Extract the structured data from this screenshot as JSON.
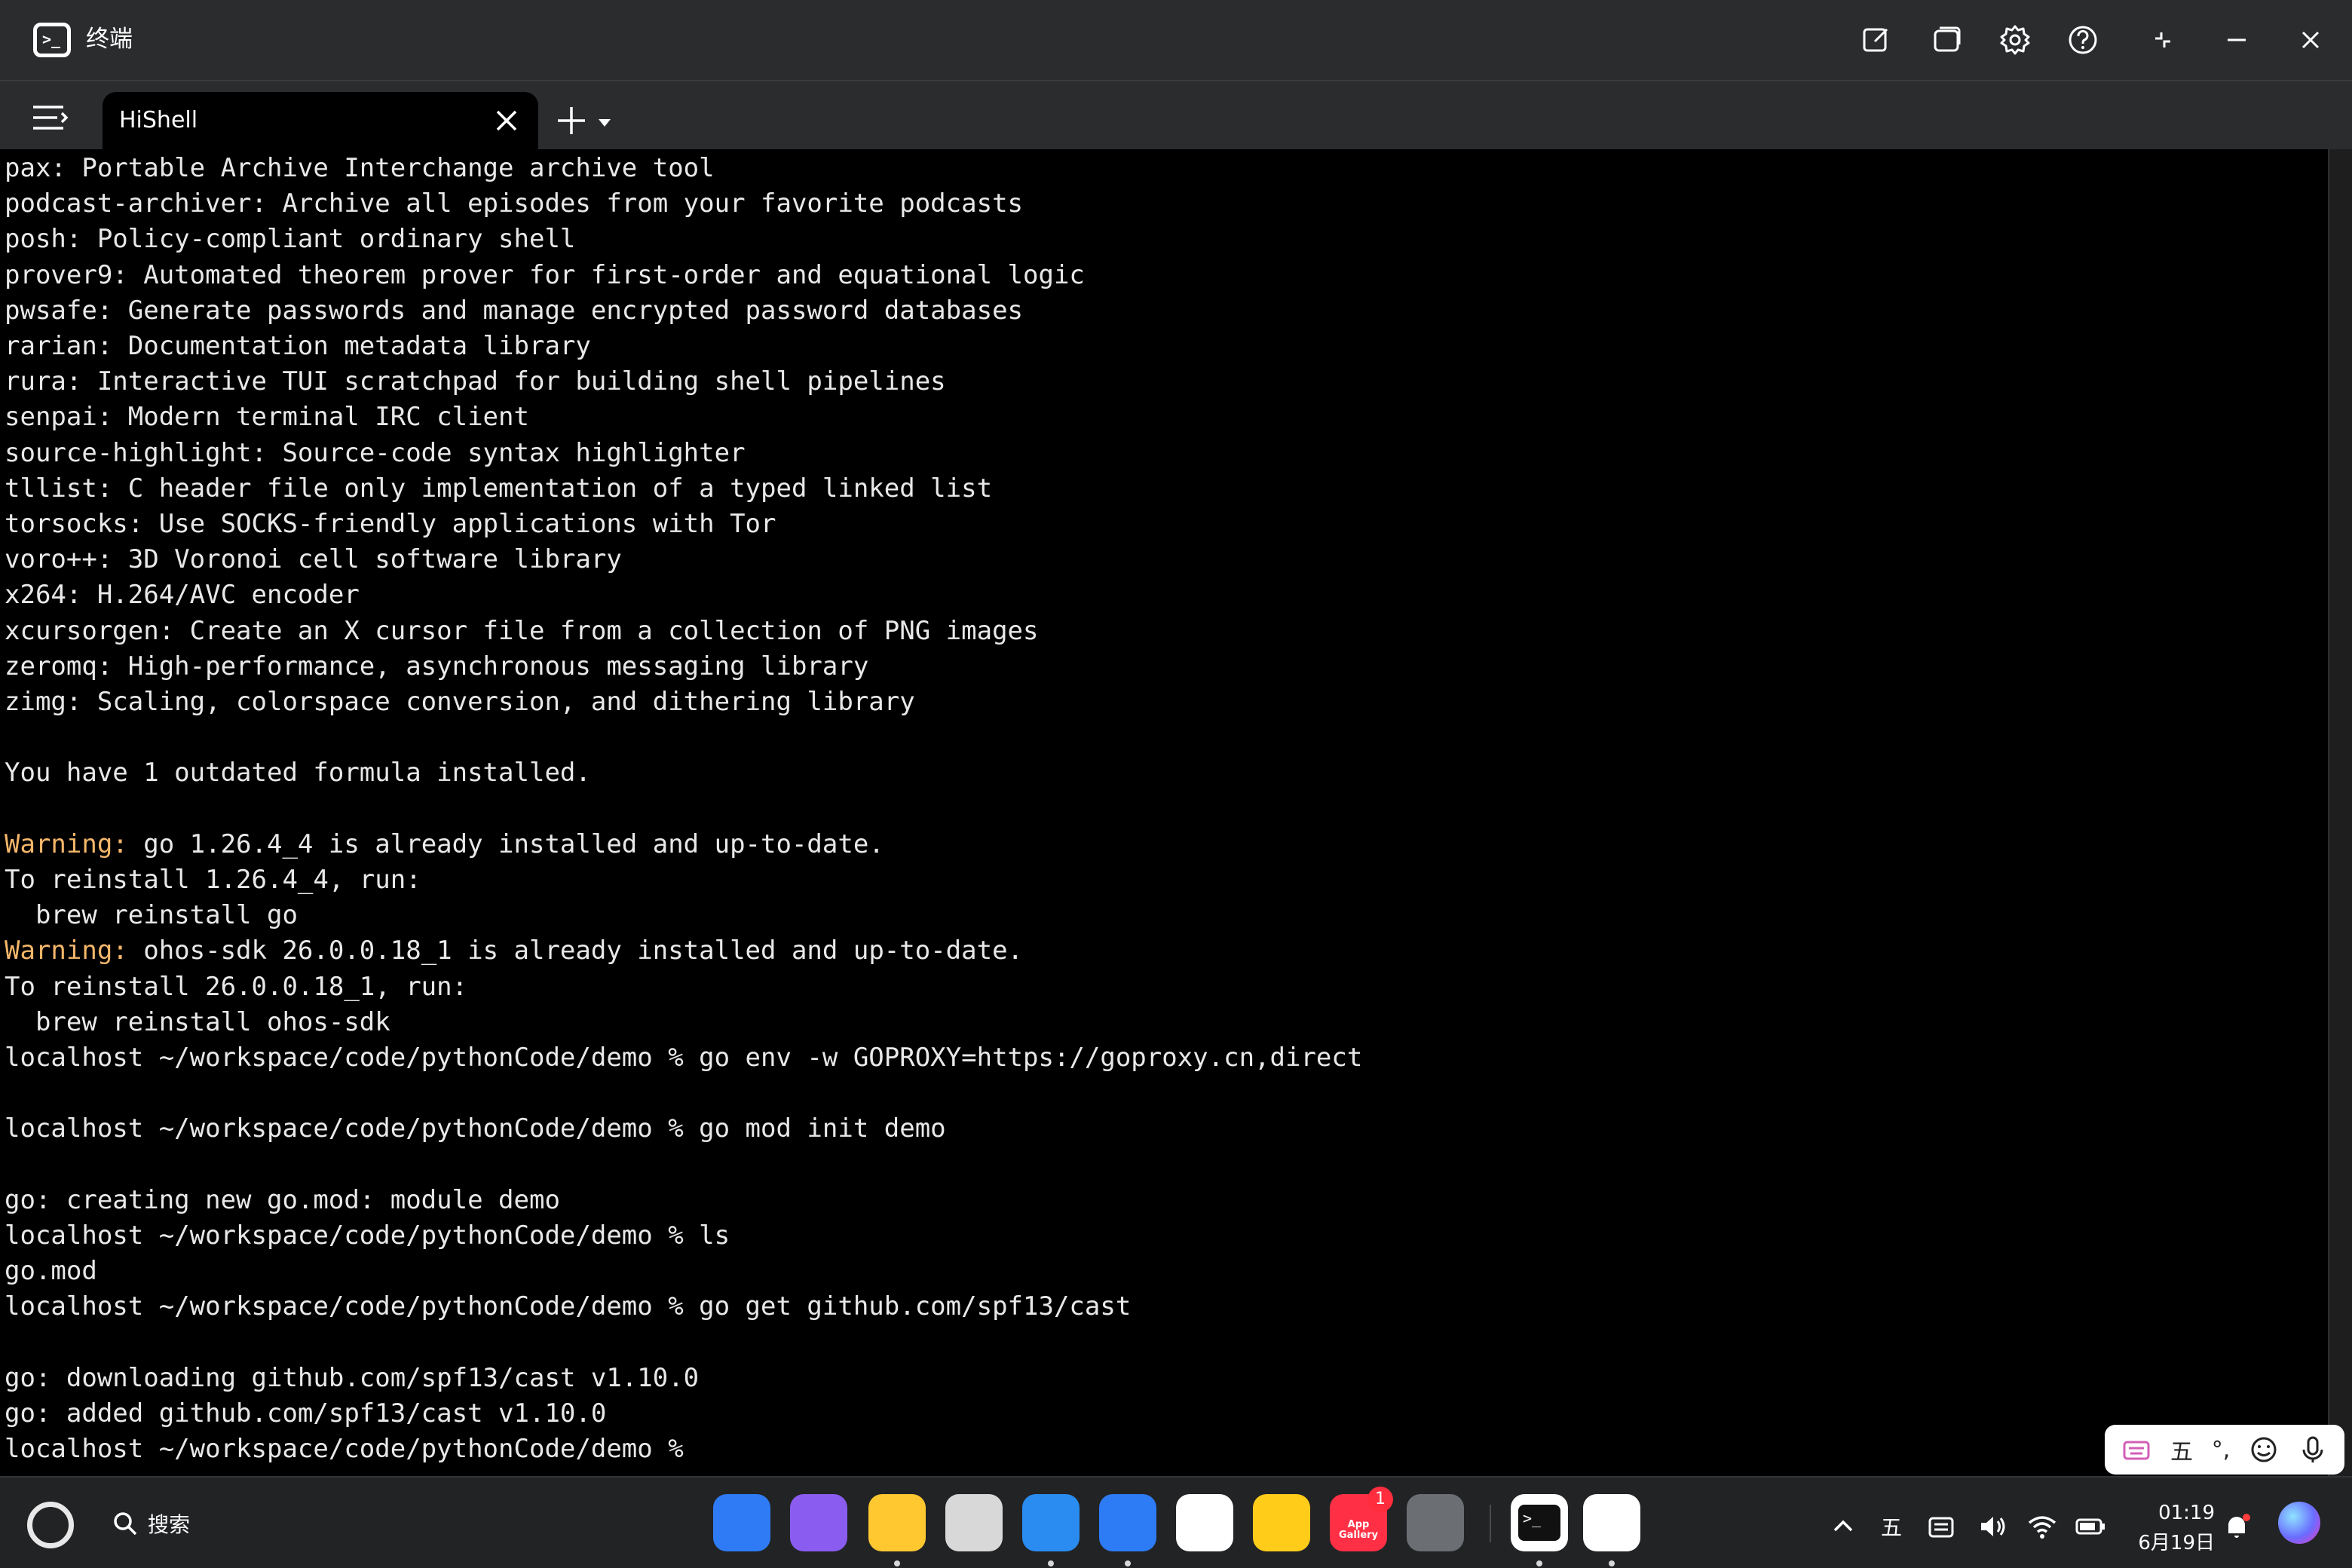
{
  "window": {
    "title": "终端"
  },
  "tabs": [
    {
      "label": "HiShell"
    }
  ],
  "terminal_lines": [
    "pax: Portable Archive Interchange archive tool",
    "podcast-archiver: Archive all episodes from your favorite podcasts",
    "posh: Policy-compliant ordinary shell",
    "prover9: Automated theorem prover for first-order and equational logic",
    "pwsafe: Generate passwords and manage encrypted password databases",
    "rarian: Documentation metadata library",
    "rura: Interactive TUI scratchpad for building shell pipelines",
    "senpai: Modern terminal IRC client",
    "source-highlight: Source-code syntax highlighter",
    "tllist: C header file only implementation of a typed linked list",
    "torsocks: Use SOCKS-friendly applications with Tor",
    "voro++: 3D Voronoi cell software library",
    "x264: H.264/AVC encoder",
    "xcursorgen: Create an X cursor file from a collection of PNG images",
    "zeromq: High-performance, asynchronous messaging library",
    "zimg: Scaling, colorspace conversion, and dithering library",
    "",
    "You have 1 outdated formula installed.",
    "",
    "Warning: go 1.26.4_4 is already installed and up-to-date.",
    "To reinstall 1.26.4_4, run:",
    "  brew reinstall go",
    "Warning: ohos-sdk 26.0.0.18_1 is already installed and up-to-date.",
    "To reinstall 26.0.0.18_1, run:",
    "  brew reinstall ohos-sdk",
    "localhost ~/workspace/code/pythonCode/demo % go env -w GOPROXY=https://goproxy.cn,direct",
    "",
    "localhost ~/workspace/code/pythonCode/demo % go mod init demo",
    "",
    "go: creating new go.mod: module demo",
    "localhost ~/workspace/code/pythonCode/demo % ls",
    "go.mod",
    "localhost ~/workspace/code/pythonCode/demo % go get github.com/spf13/cast",
    "",
    "go: downloading github.com/spf13/cast v1.10.0",
    "go: added github.com/spf13/cast v1.10.0",
    "localhost ~/workspace/code/pythonCode/demo %"
  ],
  "warning_prefix": "Warning:",
  "colors": {
    "warning": "#f4b66a",
    "terminal_bg": "#000000",
    "chrome_bg": "#2b2c2e",
    "taskbar_bg": "#222325"
  },
  "ime": {
    "mode_label": "五",
    "punct_label": "°,",
    "emoji_icon": "emoji-icon",
    "mic_icon": "mic-icon"
  },
  "taskbar": {
    "search_label": "搜索",
    "apps": [
      {
        "name": "app-grid",
        "color": "#2f7bf5"
      },
      {
        "name": "multitask",
        "color": "#8a5cf0"
      },
      {
        "name": "files",
        "color": "#ffc830"
      },
      {
        "name": "recycle-bin",
        "color": "#d8d8d8"
      },
      {
        "name": "browser",
        "color": "#2a8cf0"
      },
      {
        "name": "mail",
        "color": "#2d7cf6"
      },
      {
        "name": "gallery",
        "color": "#ffffff"
      },
      {
        "name": "notes",
        "color": "#ffcc1a"
      },
      {
        "name": "app-gallery",
        "color": "#ff3045",
        "label": "App Gallery",
        "badge": "1"
      },
      {
        "name": "settings",
        "color": "#6b6e73"
      },
      {
        "name": "terminal",
        "color": "#ffffff"
      },
      {
        "name": "hishell",
        "color": "#ffffff"
      }
    ],
    "ime_tray_label": "五",
    "time": "01:19",
    "date": "6月19日"
  }
}
